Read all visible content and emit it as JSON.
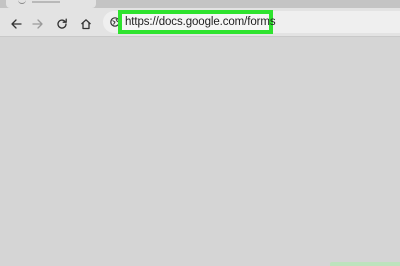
{
  "browser": {
    "address_bar": {
      "url": "https://docs.google.com/forms"
    },
    "nav_icons": [
      "back-arrow-icon",
      "forward-arrow-icon",
      "reload-icon",
      "home-icon",
      "site-info-icon"
    ],
    "highlight_color": "#2ee32e"
  }
}
